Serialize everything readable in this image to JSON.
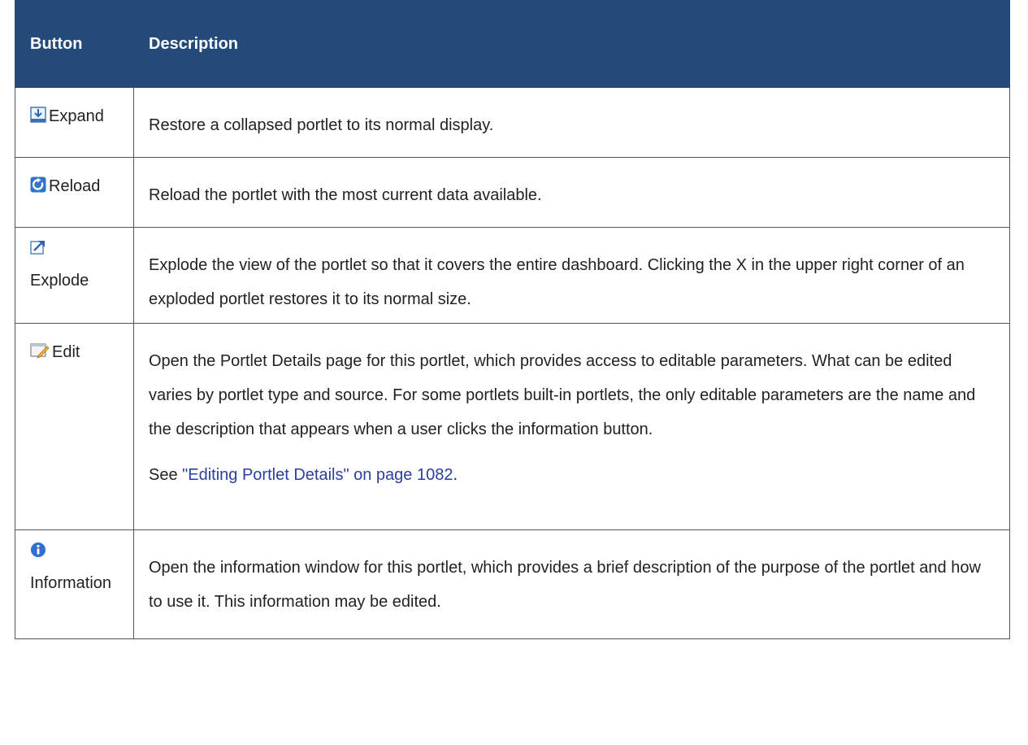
{
  "table": {
    "headers": {
      "button": "Button",
      "description": "Description"
    },
    "rows": [
      {
        "icon": "expand-icon",
        "button": "Expand",
        "description": "Restore a collapsed portlet to its normal display."
      },
      {
        "icon": "reload-icon",
        "button": "Reload",
        "description": "Reload the portlet with the most current data available."
      },
      {
        "icon": "explode-icon",
        "button": "Explode",
        "description": "Explode the view of the portlet so that it covers the entire dashboard. Clicking the X in the upper right corner of an exploded portlet restores it to its normal size."
      },
      {
        "icon": "edit-icon",
        "button": "Edit",
        "description": "Open the Portlet Details page for this portlet, which provides access to editable parameters. What can be edited varies by portlet type and source. For some portlets built-in portlets, the only editable parameters are the name and the description that appears when a user clicks the information button.",
        "see_prefix": "See ",
        "see_link": "\"Editing Portlet Details\" on page 1082",
        "see_suffix": "."
      },
      {
        "icon": "information-icon",
        "button": "Information",
        "description": "Open the information window for this portlet, which provides a brief description of the purpose of the portlet and how to use it. This information may be edited."
      }
    ]
  },
  "colors": {
    "header_bg": "#234a78",
    "header_text": "#ffffff",
    "link": "#2b3f9e"
  }
}
